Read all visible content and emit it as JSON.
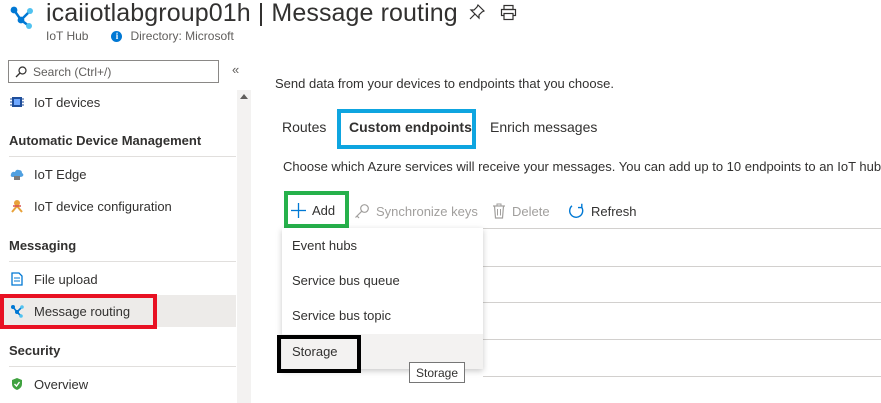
{
  "header": {
    "resource_name": "icaiiotlabgroup01h",
    "separator": " | ",
    "page_name": "Message routing",
    "resource_type": "IoT Hub",
    "directory": "Directory: Microsoft"
  },
  "sidebar": {
    "search_placeholder": "Search (Ctrl+/)",
    "collapse_glyph": "«",
    "items": [
      {
        "label": "IoT devices",
        "icon": "iot-devices-icon"
      },
      {
        "section": "Automatic Device Management"
      },
      {
        "label": "IoT Edge",
        "icon": "iot-edge-icon"
      },
      {
        "label": "IoT device configuration",
        "icon": "device-configuration-icon"
      },
      {
        "section": "Messaging"
      },
      {
        "label": "File upload",
        "icon": "file-upload-icon"
      },
      {
        "label": "Message routing",
        "icon": "message-routing-icon",
        "selected": true
      },
      {
        "section": "Security"
      },
      {
        "label": "Overview",
        "icon": "security-shield-icon"
      }
    ]
  },
  "main": {
    "intro": "Send data from your devices to endpoints that you choose.",
    "tabs": [
      {
        "label": "Routes",
        "active": false
      },
      {
        "label": "Custom endpoints",
        "active": true
      },
      {
        "label": "Enrich messages",
        "active": false
      }
    ],
    "description": "Choose which Azure services will receive your messages. You can add up to 10 endpoints to an IoT hub.",
    "commands": [
      {
        "label": "Add",
        "icon": "plus-icon",
        "enabled": true
      },
      {
        "label": "Synchronize keys",
        "icon": "key-icon",
        "enabled": false
      },
      {
        "label": "Delete",
        "icon": "trash-icon",
        "enabled": false
      },
      {
        "label": "Refresh",
        "icon": "refresh-icon",
        "enabled": true
      }
    ],
    "add_menu": [
      "Event hubs",
      "Service bus queue",
      "Service bus topic",
      "Storage"
    ],
    "tooltip": "Storage"
  },
  "colors": {
    "accent": "#0078d4",
    "highlight_red": "#e81123",
    "highlight_blue": "#0ea5e0",
    "highlight_green": "#26b14b",
    "highlight_black": "#000000"
  }
}
